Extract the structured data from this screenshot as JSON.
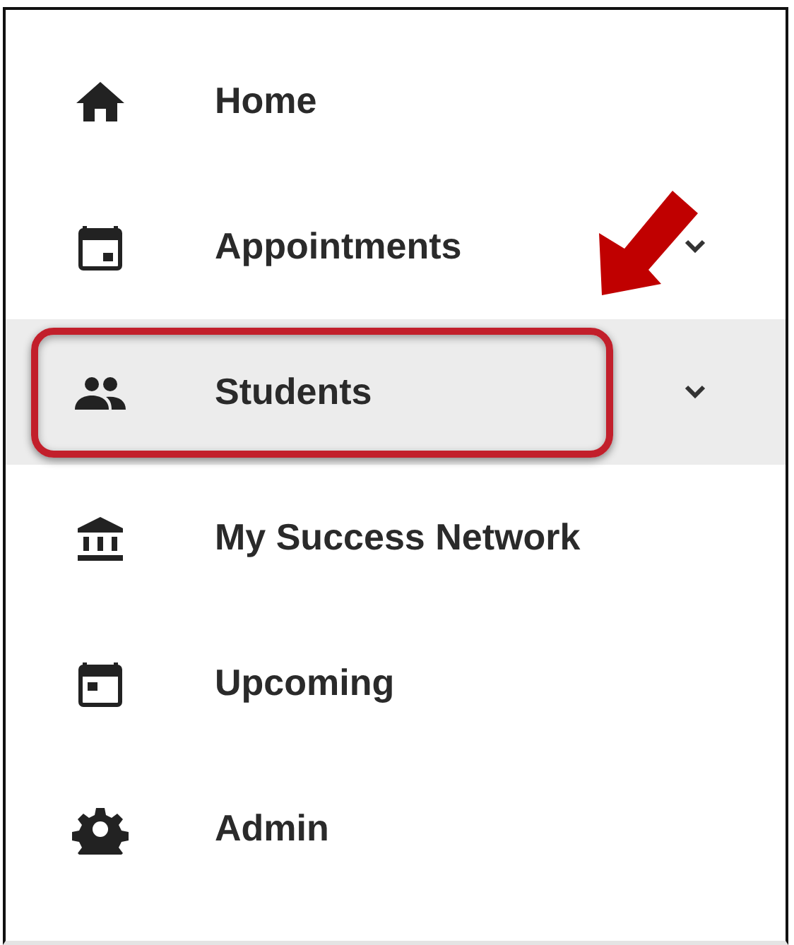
{
  "menu": {
    "items": [
      {
        "label": "Home",
        "kind": "home",
        "expandable": false,
        "selected": false,
        "highlighted": false
      },
      {
        "label": "Appointments",
        "kind": "calendar",
        "expandable": true,
        "selected": false,
        "highlighted": false
      },
      {
        "label": "Students",
        "kind": "people",
        "expandable": true,
        "selected": true,
        "highlighted": true
      },
      {
        "label": "My Success Network",
        "kind": "institution",
        "expandable": false,
        "selected": false,
        "highlighted": false
      },
      {
        "label": "Upcoming",
        "kind": "event",
        "expandable": false,
        "selected": false,
        "highlighted": false
      },
      {
        "label": "Admin",
        "kind": "gear",
        "expandable": false,
        "selected": false,
        "highlighted": false
      }
    ]
  }
}
